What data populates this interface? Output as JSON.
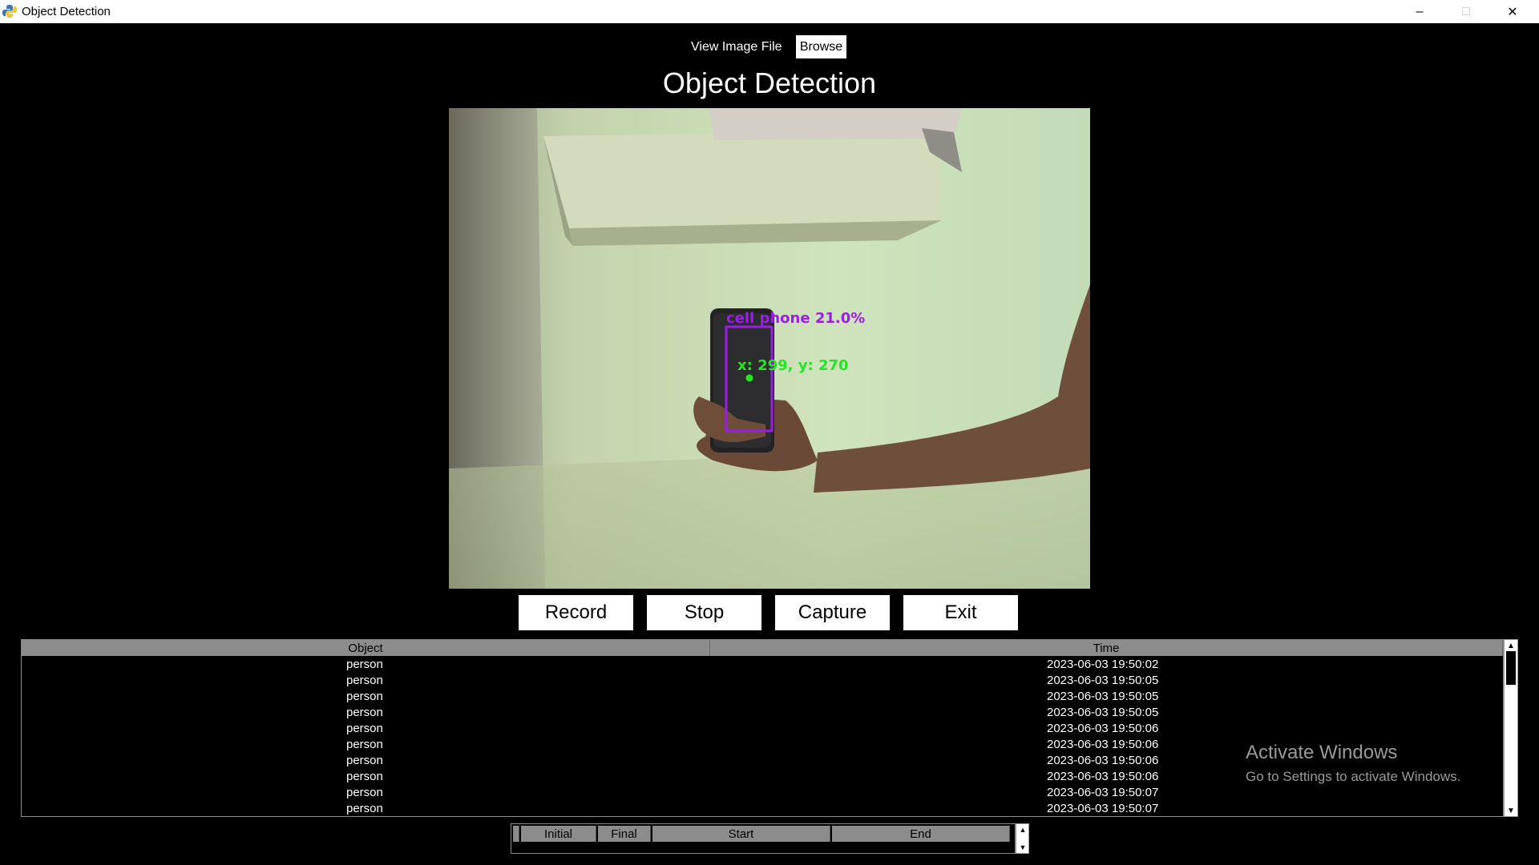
{
  "window": {
    "title": "Object Detection",
    "min_glyph": "–",
    "max_glyph": "□",
    "close_glyph": "✕"
  },
  "toolbar": {
    "view_label": "View Image File",
    "browse_label": "Browse"
  },
  "page_title": "Object Detection",
  "detection": {
    "label": "cell phone 21.0%",
    "coords_label": "x: 299, y: 270",
    "box_color": "#9b1ee6",
    "point_color": "#22e622"
  },
  "controls": {
    "record": "Record",
    "stop": "Stop",
    "capture": "Capture",
    "exit": "Exit"
  },
  "log_table": {
    "columns": [
      "Object",
      "Time"
    ],
    "rows": [
      [
        "person",
        "2023-06-03 19:50:02"
      ],
      [
        "person",
        "2023-06-03 19:50:05"
      ],
      [
        "person",
        "2023-06-03 19:50:05"
      ],
      [
        "person",
        "2023-06-03 19:50:05"
      ],
      [
        "person",
        "2023-06-03 19:50:06"
      ],
      [
        "person",
        "2023-06-03 19:50:06"
      ],
      [
        "person",
        "2023-06-03 19:50:06"
      ],
      [
        "person",
        "2023-06-03 19:50:06"
      ],
      [
        "person",
        "2023-06-03 19:50:07"
      ],
      [
        "person",
        "2023-06-03 19:50:07"
      ]
    ]
  },
  "session_table": {
    "columns": [
      "Initial",
      "Final",
      "Start",
      "End"
    ]
  },
  "watermark": {
    "title": "Activate Windows",
    "subtitle": "Go to Settings to activate Windows."
  },
  "icons": {
    "app": "python-icon",
    "scroll_up": "▲",
    "scroll_down": "▼"
  }
}
